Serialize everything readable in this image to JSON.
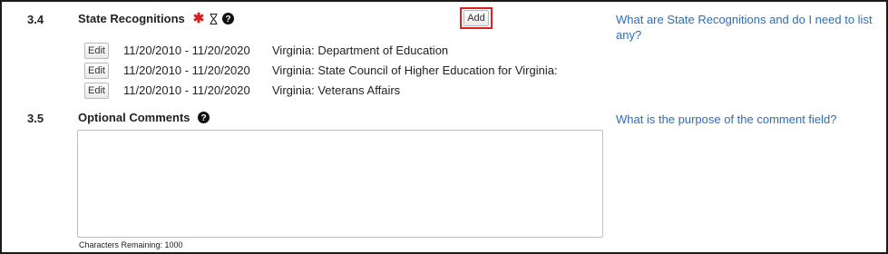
{
  "section_34": {
    "number": "3.4",
    "title": "State Recognitions",
    "add_label": "Add",
    "help_link": "What are State Recognitions and do I need to list any?",
    "rows": [
      {
        "edit_label": "Edit",
        "dates": "11/20/2010 - 11/20/2020",
        "description": "Virginia: Department of Education"
      },
      {
        "edit_label": "Edit",
        "dates": "11/20/2010 - 11/20/2020",
        "description": "Virginia: State Council of Higher Education for Virginia:"
      },
      {
        "edit_label": "Edit",
        "dates": "11/20/2010 - 11/20/2020",
        "description": "Virginia: Veterans Affairs"
      }
    ]
  },
  "section_35": {
    "number": "3.5",
    "title": "Optional Comments",
    "help_link": "What is the purpose of the comment field?",
    "comment_value": "",
    "characters_remaining": "Characters Remaining: 1000"
  },
  "icons": {
    "required": "asterisk-icon",
    "pending": "hourglass-icon",
    "help": "question-circle-icon"
  },
  "colors": {
    "link": "#2a6ebb",
    "required": "#d21f1f",
    "highlight": "#e02020"
  }
}
